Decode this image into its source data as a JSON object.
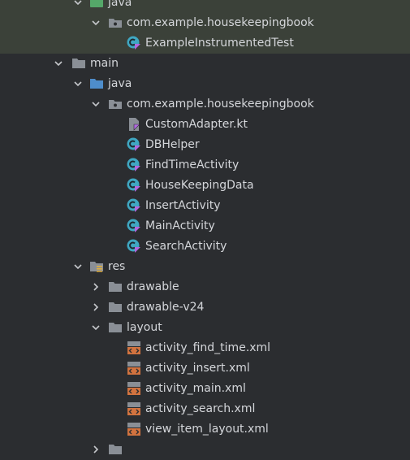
{
  "tree": {
    "test_java": {
      "label": "java"
    },
    "test_package": {
      "label": "com.example.housekeepingbook"
    },
    "test_file": {
      "label": "ExampleInstrumentedTest"
    },
    "main": {
      "label": "main"
    },
    "main_java": {
      "label": "java"
    },
    "main_package": {
      "label": "com.example.housekeepingbook"
    },
    "main_files": [
      {
        "label": "CustomAdapter.kt",
        "type": "kotlin-file"
      },
      {
        "label": "DBHelper",
        "type": "kotlin-class"
      },
      {
        "label": "FindTimeActivity",
        "type": "kotlin-class"
      },
      {
        "label": "HouseKeepingData",
        "type": "kotlin-class"
      },
      {
        "label": "InsertActivity",
        "type": "kotlin-class"
      },
      {
        "label": "MainActivity",
        "type": "kotlin-class"
      },
      {
        "label": "SearchActivity",
        "type": "kotlin-class"
      }
    ],
    "res": {
      "label": "res"
    },
    "drawable": {
      "label": "drawable"
    },
    "drawable_v24": {
      "label": "drawable-v24"
    },
    "layout": {
      "label": "layout"
    },
    "layout_files": [
      {
        "label": "activity_find_time.xml"
      },
      {
        "label": "activity_insert.xml"
      },
      {
        "label": "activity_main.xml"
      },
      {
        "label": "activity_search.xml"
      },
      {
        "label": "view_item_layout.xml"
      }
    ]
  },
  "colors": {
    "background": "#2b2d30",
    "selected_group": "#3b4139",
    "folder_gray": "#8a8f96",
    "folder_blue": "#4e8dcb",
    "folder_green": "#55a869",
    "class_teal": "#3fa7c2",
    "kotlin_purple": "#b168e0",
    "xml_orange": "#d2733f"
  }
}
